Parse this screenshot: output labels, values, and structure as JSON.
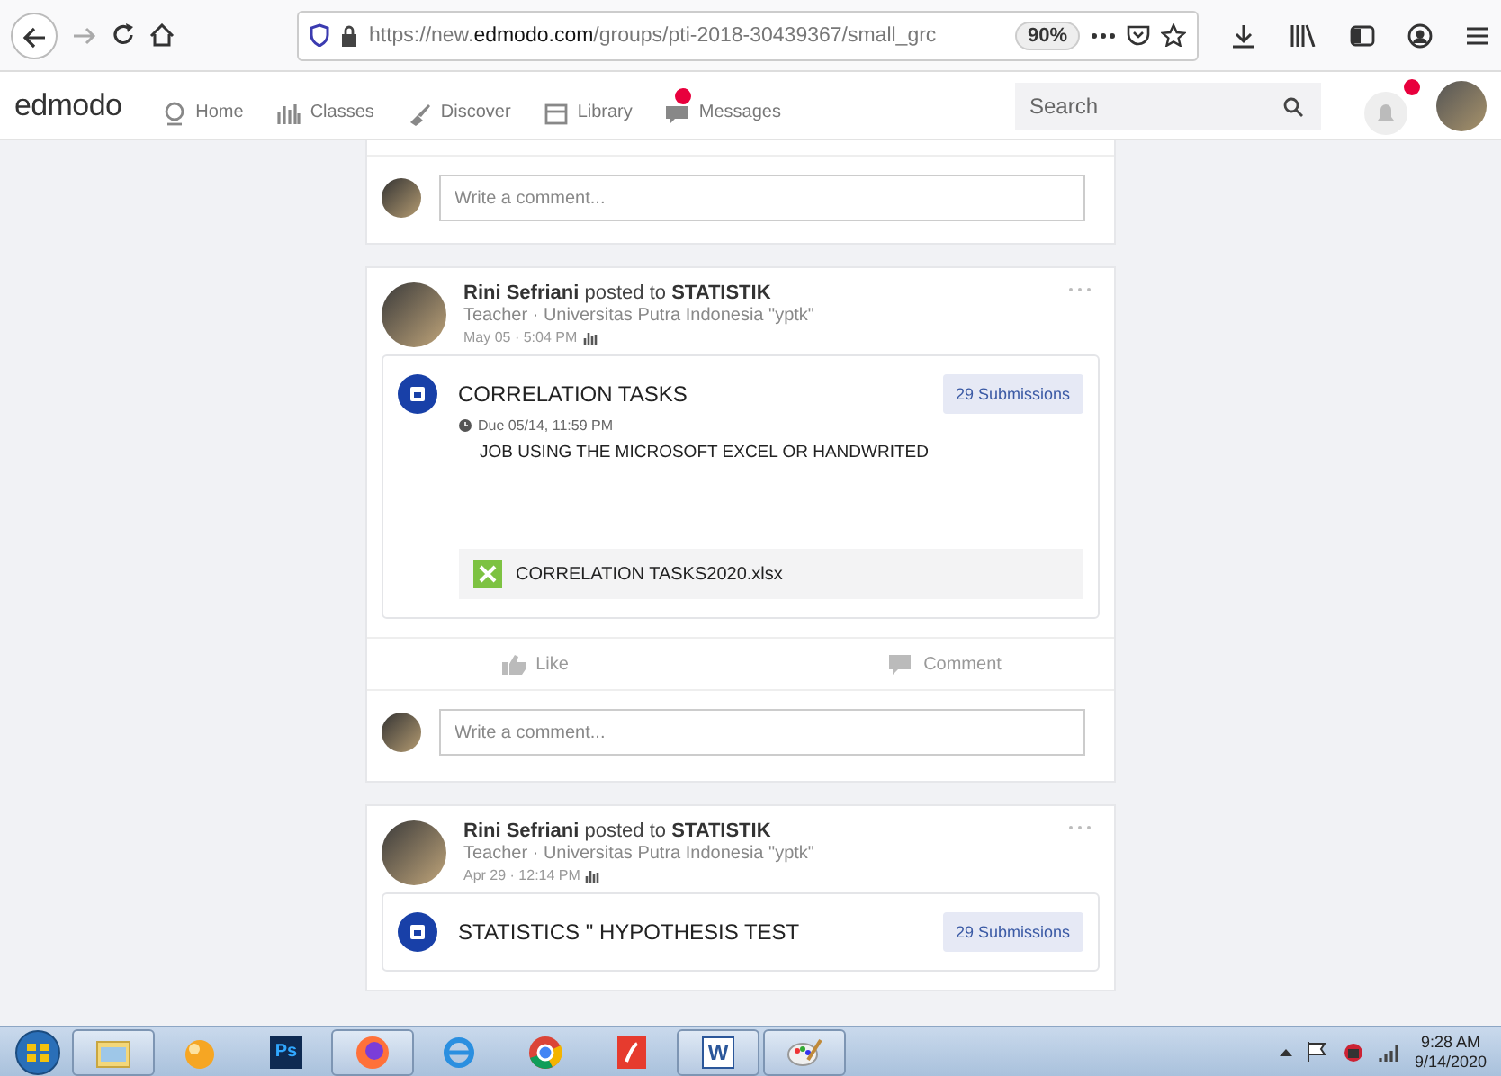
{
  "browser": {
    "url_scheme": "https://new.",
    "url_domain": "edmodo.com",
    "url_path": "/groups/pti-2018-30439367/small_grc",
    "zoom": "90%"
  },
  "nav": {
    "logo": "edmodo",
    "items": [
      {
        "label": "Home",
        "badge": false
      },
      {
        "label": "Classes",
        "badge": false
      },
      {
        "label": "Discover",
        "badge": false
      },
      {
        "label": "Library",
        "badge": false
      },
      {
        "label": "Messages",
        "badge": true
      }
    ],
    "search": {
      "placeholder": "Search"
    },
    "notifications_badge": true
  },
  "feed": {
    "top_comment": {
      "placeholder": "Write a comment..."
    },
    "posts": [
      {
        "author": "Rini Sefriani",
        "action": "posted to",
        "group": "STATISTIK",
        "role": "Teacher · Universitas Putra Indonesia \"yptk\"",
        "time": "May 05 · 5:04 PM",
        "assignment": {
          "title": "CORRELATION TASKS",
          "submissions": "29 Submissions",
          "due": "Due 05/14, 11:59 PM",
          "description": "JOB USING THE MICROSOFT EXCEL OR HANDWRITED",
          "attachment": "CORRELATION TASKS2020.xlsx"
        },
        "actions": [
          {
            "label": "Like",
            "kind": "like"
          },
          {
            "label": "Comment",
            "kind": "comment"
          }
        ],
        "comment_placeholder": "Write a comment..."
      },
      {
        "author": "Rini Sefriani",
        "action": "posted to",
        "group": "STATISTIK",
        "role": "Teacher · Universitas Putra Indonesia \"yptk\"",
        "time": "Apr 29 · 12:14 PM",
        "assignment": {
          "title": "STATISTICS \" HYPOTHESIS TEST",
          "submissions": "29 Submissions"
        }
      }
    ]
  },
  "taskbar": {
    "apps": [
      {
        "kind": "explorer",
        "running": true
      },
      {
        "kind": "orb",
        "running": false
      },
      {
        "kind": "photoshop",
        "label": "Ps",
        "running": false
      },
      {
        "kind": "firefox",
        "running": true
      },
      {
        "kind": "ie",
        "running": false
      },
      {
        "kind": "chrome",
        "running": false
      },
      {
        "kind": "reader",
        "running": false
      },
      {
        "kind": "word",
        "label": "W",
        "running": true
      },
      {
        "kind": "paint",
        "running": true
      }
    ],
    "time": "9:28 AM",
    "date": "9/14/2020"
  }
}
